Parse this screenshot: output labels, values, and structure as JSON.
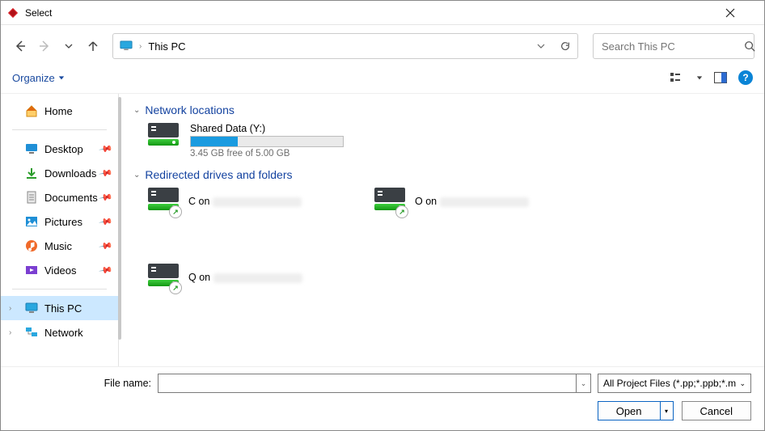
{
  "window": {
    "title": "Select"
  },
  "nav": {
    "address": "This PC"
  },
  "search": {
    "placeholder": "Search This PC"
  },
  "toolbar": {
    "organize": "Organize"
  },
  "sidebar": {
    "home": "Home",
    "items": [
      {
        "label": "Desktop"
      },
      {
        "label": "Downloads"
      },
      {
        "label": "Documents"
      },
      {
        "label": "Pictures"
      },
      {
        "label": "Music"
      },
      {
        "label": "Videos"
      }
    ],
    "this_pc": "This PC",
    "network": "Network"
  },
  "content": {
    "group1": "Network locations",
    "shared": {
      "name": "Shared Data (Y:)",
      "usage_text": "3.45 GB free of 5.00 GB",
      "fill_pct": 31
    },
    "group2": "Redirected drives and folders",
    "redir": [
      {
        "prefix": "C on"
      },
      {
        "prefix": "O on"
      },
      {
        "prefix": "Q on"
      }
    ]
  },
  "footer": {
    "file_label": "File name:",
    "file_value": "",
    "filter": "All Project Files (*.pp;*.ppb;*.m",
    "open": "Open",
    "cancel": "Cancel"
  }
}
